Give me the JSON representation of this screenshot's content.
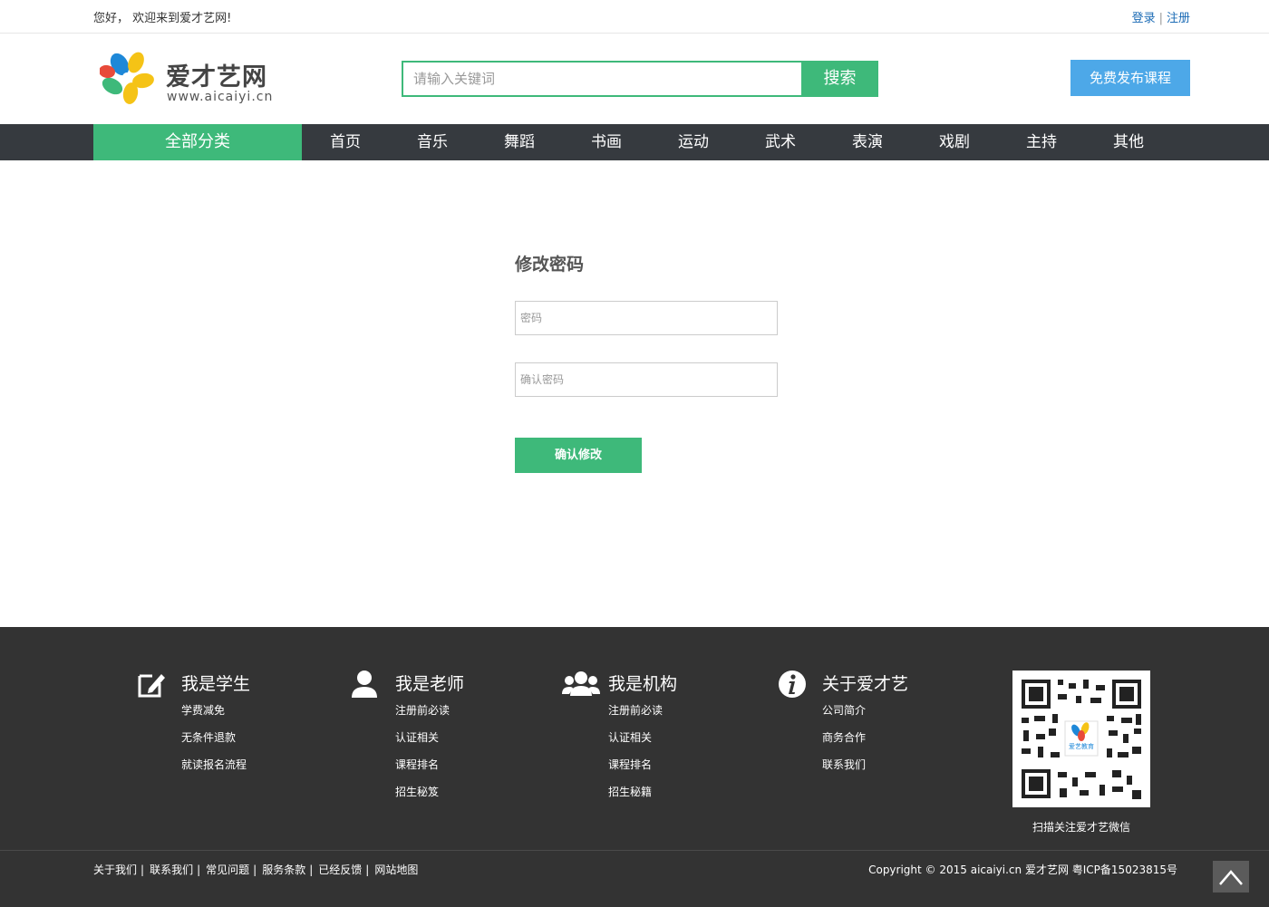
{
  "topbar": {
    "welcome": "您好， 欢迎来到爱才艺网!",
    "login": "登录",
    "separator": "|",
    "register": "注册"
  },
  "header": {
    "logo_name": "爱才艺网",
    "logo_url": "www.aicaiyi.cn",
    "search_placeholder": "请输入关键词",
    "search_button": "搜索",
    "publish_button": "免费发布课程"
  },
  "nav": {
    "all_categories": "全部分类",
    "items": [
      "首页",
      "音乐",
      "舞蹈",
      "书画",
      "运动",
      "武术",
      "表演",
      "戏剧",
      "主持",
      "其他"
    ]
  },
  "form": {
    "title": "修改密码",
    "password_placeholder": "密码",
    "confirm_placeholder": "确认密码",
    "submit": "确认修改"
  },
  "footer": {
    "columns": [
      {
        "icon": "edit-icon",
        "title": "我是学生",
        "links": [
          "学费减免",
          "无条件退款",
          "就读报名流程"
        ]
      },
      {
        "icon": "user-icon",
        "title": "我是老师",
        "links": [
          "注册前必读",
          "认证相关",
          "课程排名",
          "招生秘笈"
        ]
      },
      {
        "icon": "group-icon",
        "title": "我是机构",
        "links": [
          "注册前必读",
          "认证相关",
          "课程排名",
          "招生秘籍"
        ]
      },
      {
        "icon": "info-icon",
        "title": "关于爱才艺",
        "links": [
          "公司简介",
          "商务合作",
          "联系我们"
        ]
      }
    ],
    "qr_caption": "扫描关注爱才艺微信",
    "qr_center_text": "爱艺教育",
    "bottom_links": [
      "关于我们",
      "联系我们",
      "常见问题",
      "服务条款",
      "已经反馈",
      "网站地图"
    ],
    "link_separator": "|",
    "copyright": "Copyright © 2015 aicaiyi.cn 爱才艺网 粤ICP备15023815号"
  },
  "colors": {
    "accent_green": "#3eb97a",
    "publish_blue": "#4da8e8",
    "nav_dark": "#363a3f",
    "footer_dark": "#333333",
    "link_blue": "#1b6bb5"
  }
}
